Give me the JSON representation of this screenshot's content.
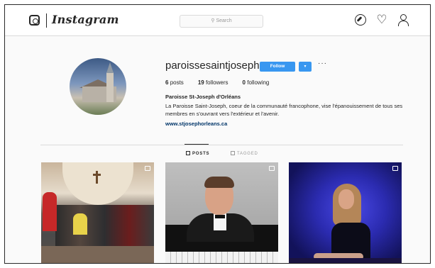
{
  "topnav": {
    "wordmark": "Instagram",
    "search_placeholder": "Search",
    "icons": [
      "instagram-camera-icon",
      "compass-icon",
      "heart-icon",
      "profile-icon"
    ]
  },
  "profile": {
    "username": "paroissesaintjoseph",
    "follow_label": "Follow",
    "dropdown_label": "▾",
    "more_label": "···",
    "stats": {
      "posts_count": "6",
      "posts_label": "posts",
      "followers_count": "19",
      "followers_label": "followers",
      "following_count": "0",
      "following_label": "following"
    },
    "bio_name": "Paroisse St-Joseph d'Orléans",
    "bio_text": "La Paroisse Saint-Joseph, coeur de la communauté francophone, vise l'épanouissement de tous ses membres en s'ouvrant vers l'extérieur et l'avenir.",
    "bio_link": "www.stjosephorleans.ca"
  },
  "tabs": {
    "posts": "POSTS",
    "tagged": "TAGGED"
  },
  "colors": {
    "accent": "#3897f0",
    "text": "#262626",
    "border": "#dbdbdb",
    "background": "#fafafa"
  }
}
